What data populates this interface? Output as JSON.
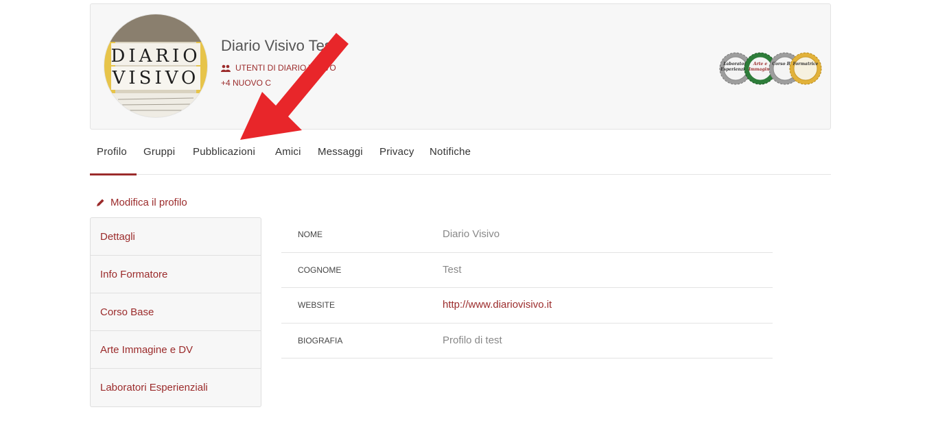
{
  "profile": {
    "name": "Diario Visivo Test",
    "group": "UTENTI DI DIARIO VISIVO",
    "new_count": "+4 NUOVO C",
    "avatar_text_line1": "DIARIO",
    "avatar_text_line2": "VISIVO"
  },
  "badges": [
    {
      "label": "Laboratori Esperienziali",
      "color": "#9e9e9e"
    },
    {
      "label": "Arte e Immagine",
      "color": "#2e7d3a"
    },
    {
      "label": "Corso Base",
      "color": "#9e9e9e"
    },
    {
      "label": "Formatrice",
      "color": "#e2b23a"
    }
  ],
  "tabs": [
    {
      "label": "Profilo"
    },
    {
      "label": "Gruppi"
    },
    {
      "label": "Pubblicazioni"
    },
    {
      "label": "Amici"
    },
    {
      "label": "Messaggi"
    },
    {
      "label": "Privacy"
    },
    {
      "label": "Notifiche"
    }
  ],
  "edit_profile": {
    "label": "Modifica il profilo",
    "icon": "pencil-icon"
  },
  "side_menu": [
    {
      "label": "Dettagli"
    },
    {
      "label": "Info Formatore"
    },
    {
      "label": "Corso Base"
    },
    {
      "label": "Arte Immagine e DV"
    },
    {
      "label": "Laboratori Esperienziali"
    }
  ],
  "details": [
    {
      "label": "NOME",
      "value": "Diario Visivo"
    },
    {
      "label": "COGNOME",
      "value": "Test"
    },
    {
      "label": "WEBSITE",
      "value": "http://www.diariovisivo.it"
    },
    {
      "label": "BIOGRAFIA",
      "value": "Profilo di test"
    }
  ],
  "colors": {
    "accent": "#9b2b2b",
    "arrow": "#e8262a"
  }
}
